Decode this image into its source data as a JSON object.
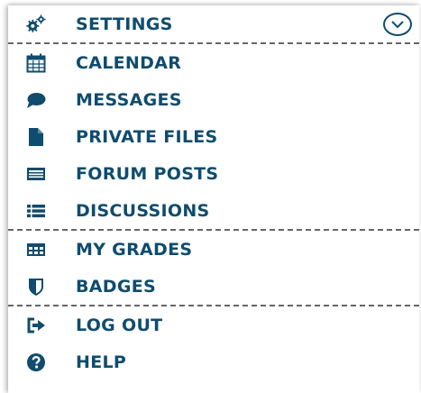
{
  "colors": {
    "text": "#0f4c6e",
    "divider": "#666666",
    "background": "#ffffff"
  },
  "menu": {
    "settings": {
      "label": "SETTINGS",
      "icon": "gears-icon",
      "toggle_icon": "chevron-down-circle-icon"
    },
    "calendar": {
      "label": "CALENDAR",
      "icon": "calendar-icon"
    },
    "messages": {
      "label": "MESSAGES",
      "icon": "speech-bubble-icon"
    },
    "private_files": {
      "label": "PRIVATE FILES",
      "icon": "file-icon"
    },
    "forum_posts": {
      "label": "FORUM POSTS",
      "icon": "forum-icon"
    },
    "discussions": {
      "label": "DISCUSSIONS",
      "icon": "list-icon"
    },
    "my_grades": {
      "label": "MY GRADES",
      "icon": "grid-icon"
    },
    "badges": {
      "label": "BADGES",
      "icon": "shield-icon"
    },
    "log_out": {
      "label": "LOG OUT",
      "icon": "sign-out-icon"
    },
    "help": {
      "label": "HELP",
      "icon": "question-circle-icon"
    }
  }
}
